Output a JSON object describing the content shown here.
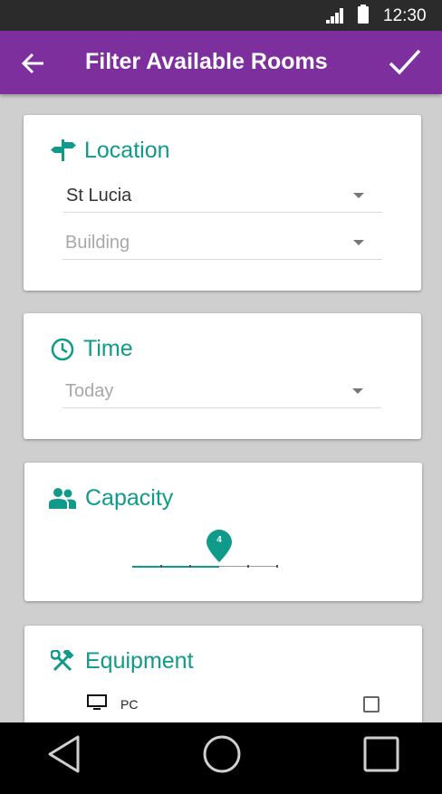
{
  "status_bar": {
    "time": "12:30",
    "icons": [
      "signal-icon",
      "battery-icon"
    ]
  },
  "app_bar": {
    "title": "Filter Available Rooms",
    "back_icon": "arrow-left-icon",
    "confirm_icon": "check-icon",
    "color": "#7d2f9e"
  },
  "accent_color": "#0f9a8a",
  "location": {
    "title": "Location",
    "icon": "signpost-icon",
    "campus": {
      "value": "St Lucia"
    },
    "building": {
      "placeholder": "Building"
    }
  },
  "time_section": {
    "title": "Time",
    "icon": "clock-icon",
    "when": {
      "placeholder": "Today"
    }
  },
  "capacity": {
    "title": "Capacity",
    "icon": "people-icon",
    "slider": {
      "value": "4",
      "min": 0,
      "max": 5,
      "fraction": 0.6
    }
  },
  "equipment": {
    "title": "Equipment",
    "icon": "tools-icon",
    "items": [
      {
        "label": "PC",
        "icon": "monitor-icon",
        "checked": false
      }
    ]
  },
  "nav_bar": {
    "buttons": [
      "back-triangle-icon",
      "home-circle-icon",
      "recents-square-icon"
    ]
  }
}
